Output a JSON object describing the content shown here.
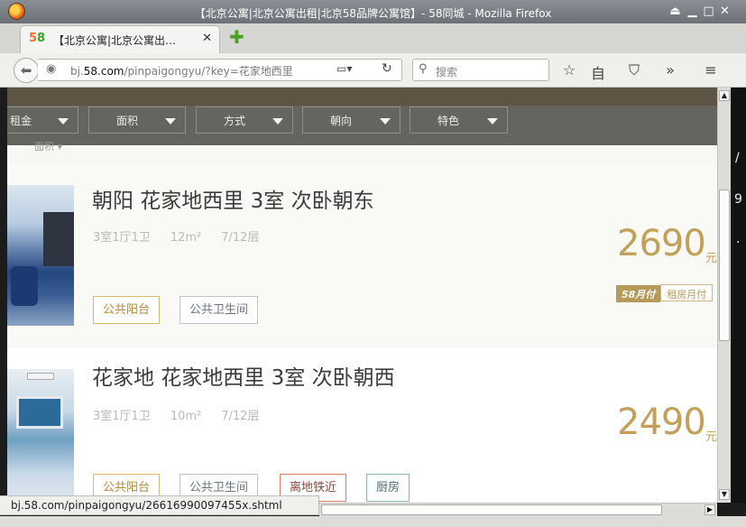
{
  "window": {
    "title": "【北京公寓|北京公寓出租|北京58品牌公寓馆】- 58同城 - Mozilla Firefox",
    "controls": [
      "⏏",
      "▁",
      "□",
      "✕"
    ]
  },
  "tab": {
    "logo_a": "5",
    "logo_b": "8",
    "label": "【北京公寓|北京公寓出…",
    "close": "✕",
    "new_tab": "✚"
  },
  "nav": {
    "back": "⬅",
    "url_prefix": "bj.",
    "url_domain": "58.com",
    "url_path": "/pinpaigongyu/?key=花家地西里",
    "reader": "▭▾",
    "reload": "↻",
    "search_placeholder": "搜索",
    "toolbar_icons": [
      "☆",
      "自",
      "⛉",
      "»",
      "≡"
    ]
  },
  "filters": [
    {
      "label": "租金"
    },
    {
      "label": "面积"
    },
    {
      "label": "方式"
    },
    {
      "label": "朝向"
    },
    {
      "label": "特色"
    }
  ],
  "subhead": "面积 ▾",
  "listings": [
    {
      "title": "朝阳 花家地西里 3室 次卧朝东",
      "layout": "3室1厅1卫",
      "area": "12m²",
      "floor": "7/12层",
      "price": "2690",
      "unit": "元",
      "pay_a": "58月付",
      "pay_b": "租房月付",
      "tags": [
        "公共阳台",
        "公共卫生间"
      ]
    },
    {
      "title": "花家地 花家地西里 3室 次卧朝西",
      "layout": "3室1厅1卫",
      "area": "10m²",
      "floor": "7/12层",
      "price": "2490",
      "unit": "元",
      "tags": [
        "公共阳台",
        "公共卫生间",
        "离地铁近",
        "厨房"
      ]
    }
  ],
  "status_url": "bj.58.com/pinpaigongyu/26616990097455x.shtml",
  "right_chars": [
    "/",
    "9",
    "·"
  ],
  "scroll_arrows": {
    "up": "▲",
    "down": "▼",
    "right": "▶"
  }
}
